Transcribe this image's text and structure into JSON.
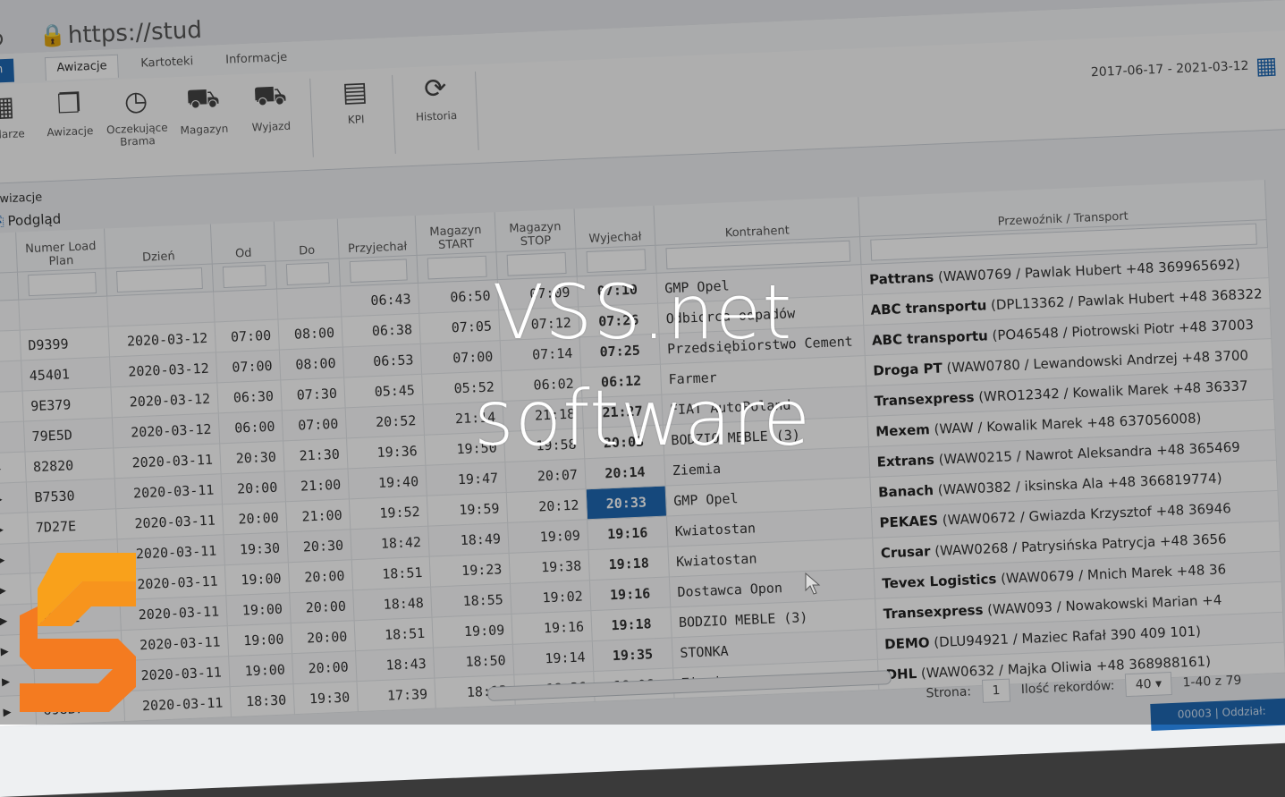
{
  "browser": {
    "url": "https://stud"
  },
  "tabs": {
    "system": "tem",
    "awizacje": "Awizacje",
    "kartoteki": "Kartoteki",
    "informacje": "Informacje"
  },
  "toolbar": {
    "kalendarze": "endarze",
    "awizacje": "Awizacje",
    "oczekujace": "Oczekujące Brama",
    "magazyn": "Magazyn",
    "wyjazd": "Wyjazd",
    "kpi": "KPI",
    "historia": "Historia"
  },
  "date_range": "2017-06-17 - 2021-03-12",
  "section": {
    "title": "awizacje",
    "preview": "Podgląd"
  },
  "columns": {
    "numer": "Numer Load Plan",
    "dzien": "Dzień",
    "od": "Od",
    "do": "Do",
    "przyjechal": "Przyjechał",
    "mag_start": "Magazyn START",
    "mag_stop": "Magazyn STOP",
    "wyjechal": "Wyjechał",
    "kontrahent": "Kontrahent",
    "przewoznik": "Przewoźnik / Transport"
  },
  "rows": [
    {
      "id": "",
      "day": "",
      "od": "",
      "do": "",
      "arr": "06:43",
      "ms": "06:50",
      "mst": "07:09",
      "exit": "07:10",
      "contractor": "GMP Opel",
      "carrier": "Pattrans",
      "carrier_info": "(WAW0769 / Pawlak Hubert +48 369965692)"
    },
    {
      "id": "D9399",
      "day": "2020-03-12",
      "od": "07:00",
      "do": "08:00",
      "arr": "06:38",
      "ms": "07:05",
      "mst": "07:12",
      "exit": "07:26",
      "contractor": "Odbiorca odpadów",
      "carrier": "ABC transportu",
      "carrier_info": "(DPL13362 / Pawlak Hubert +48 368322"
    },
    {
      "id": "45401",
      "day": "2020-03-12",
      "od": "07:00",
      "do": "08:00",
      "arr": "06:53",
      "ms": "07:00",
      "mst": "07:14",
      "exit": "07:25",
      "contractor": "Przedsiębiorstwo Cement",
      "carrier": "ABC transportu",
      "carrier_info": "(PO46548 / Piotrowski Piotr +48 37003"
    },
    {
      "id": "9E379",
      "day": "2020-03-12",
      "od": "06:30",
      "do": "07:30",
      "arr": "05:45",
      "ms": "05:52",
      "mst": "06:02",
      "exit": "06:12",
      "contractor": "Farmer",
      "carrier": "Droga PT",
      "carrier_info": "(WAW0780 / Lewandowski Andrzej +48 3700"
    },
    {
      "id": "79E5D",
      "day": "2020-03-12",
      "od": "06:00",
      "do": "07:00",
      "arr": "20:52",
      "ms": "21:14",
      "mst": "21:18",
      "exit": "21:27",
      "contractor": "FIAT AutoPoland",
      "carrier": "Transexpress",
      "carrier_info": "(WRO12342 / Kowalik Marek +48 36337"
    },
    {
      "id": "82820",
      "day": "2020-03-11",
      "od": "20:30",
      "do": "21:30",
      "arr": "19:36",
      "ms": "19:50",
      "mst": "19:58",
      "exit": "20:03",
      "contractor": "BODZIO MEBLE (3)",
      "carrier": "Mexem",
      "carrier_info": "(WAW / Kowalik Marek +48 637056008)"
    },
    {
      "id": "B7530",
      "day": "2020-03-11",
      "od": "20:00",
      "do": "21:00",
      "arr": "19:40",
      "ms": "19:47",
      "mst": "20:07",
      "exit": "20:14",
      "contractor": "Ziemia",
      "carrier": "Extrans",
      "carrier_info": "(WAW0215 / Nawrot Aleksandra +48 365469"
    },
    {
      "id": "7D27E",
      "day": "2020-03-11",
      "od": "20:00",
      "do": "21:00",
      "arr": "19:52",
      "ms": "19:59",
      "mst": "20:12",
      "exit": "20:33",
      "contractor": "GMP Opel",
      "carrier": "Banach",
      "carrier_info": "(WAW0382 / iksinska Ala +48 366819774)",
      "selected": true
    },
    {
      "id": "",
      "day": "2020-03-11",
      "od": "19:30",
      "do": "20:30",
      "arr": "18:42",
      "ms": "18:49",
      "mst": "19:09",
      "exit": "19:16",
      "contractor": "Kwiatostan",
      "carrier": "PEKAES",
      "carrier_info": "(WAW0672 / Gwiazda Krzysztof +48 36946"
    },
    {
      "id": "",
      "day": "2020-03-11",
      "od": "19:00",
      "do": "20:00",
      "arr": "18:51",
      "ms": "19:23",
      "mst": "19:38",
      "exit": "19:18",
      "contractor": "Kwiatostan",
      "carrier": "Crusar",
      "carrier_info": "(WAW0268 / Patrysińska Patrycja +48 3656"
    },
    {
      "id": "5253E",
      "day": "2020-03-11",
      "od": "19:00",
      "do": "20:00",
      "arr": "18:48",
      "ms": "18:55",
      "mst": "19:02",
      "exit": "19:16",
      "contractor": "Dostawca Opon",
      "carrier": "Tevex Logistics",
      "carrier_info": "(WAW0679 / Mnich Marek +48 36"
    },
    {
      "id": "6",
      "day": "2020-03-11",
      "od": "19:00",
      "do": "20:00",
      "arr": "18:51",
      "ms": "19:09",
      "mst": "19:16",
      "exit": "19:18",
      "contractor": "BODZIO MEBLE (3)",
      "carrier": "Transexpress",
      "carrier_info": "(WAW093 / Nowakowski Marian +4"
    },
    {
      "id": "",
      "day": "2020-03-11",
      "od": "19:00",
      "do": "20:00",
      "arr": "18:43",
      "ms": "18:50",
      "mst": "19:14",
      "exit": "19:35",
      "contractor": "STONKA",
      "carrier": "DEMO",
      "carrier_info": "(DLU94921 / Maziec Rafał 390 409 101)"
    },
    {
      "id": "698B7",
      "day": "2020-03-11",
      "od": "18:30",
      "do": "19:30",
      "arr": "17:39",
      "ms": "18:13",
      "mst": "18:36",
      "exit": "18:06",
      "contractor": "Ziemia",
      "carrier": "DHL",
      "carrier_info": "(WAW0632 / Majka Oliwia +48 368988161)"
    }
  ],
  "pager": {
    "page_label": "Strona:",
    "page": "1",
    "records_label": "Ilość rekordów:",
    "records": "40",
    "range": "1-40 z 79"
  },
  "status_bar": "00003 | Oddział:",
  "watermark": {
    "line1": "VSS.net",
    "line2": "software"
  },
  "colors": {
    "accent": "#1f67b2",
    "logo_orange": "#f47b20",
    "logo_light": "#f9a11b"
  }
}
